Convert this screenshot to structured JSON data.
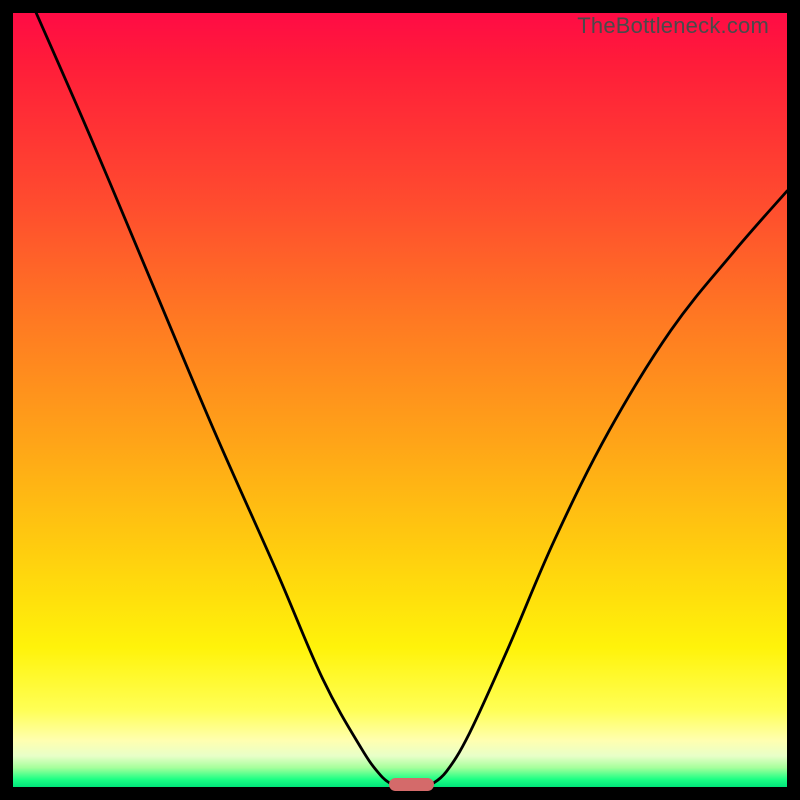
{
  "watermark": "TheBottleneck.com",
  "chart_data": {
    "type": "line",
    "title": "",
    "xlabel": "",
    "ylabel": "",
    "xlim": [
      0,
      100
    ],
    "ylim": [
      0,
      100
    ],
    "grid": false,
    "legend": false,
    "series": [
      {
        "name": "bottleneck-curve-left",
        "x": [
          3,
          10,
          18,
          26,
          34,
          40,
          45,
          47.5,
          49
        ],
        "values": [
          100,
          84,
          65,
          46,
          28,
          14,
          5,
          1.5,
          0.3
        ]
      },
      {
        "name": "bottleneck-curve-right",
        "x": [
          54,
          56,
          59,
          64,
          70,
          77,
          85,
          93,
          100
        ],
        "values": [
          0.3,
          2,
          7,
          18,
          32,
          46,
          59,
          69,
          77
        ]
      }
    ],
    "marker": {
      "name": "optimal-point",
      "x_range": [
        49,
        54
      ],
      "y": 0.3,
      "color": "#d46a6a"
    },
    "background_gradient": {
      "top": "#ff0b45",
      "mid_upper": "#ff7a22",
      "mid": "#ffcf0e",
      "mid_lower": "#ffffb0",
      "bottom": "#00e47a"
    }
  }
}
